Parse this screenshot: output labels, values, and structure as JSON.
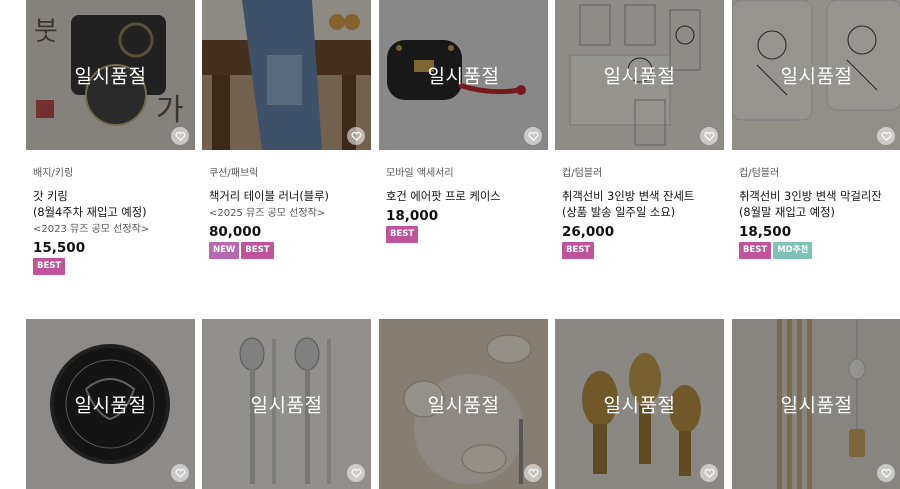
{
  "overlay_text": "일시품절",
  "colors": {
    "best": "#c0549b",
    "new": "#b76ab0",
    "md": "#7fc3b8",
    "overlay": "rgba(20,20,20,0.42)"
  },
  "products": [
    {
      "category": "배지/키링",
      "name_line1": "갓 키링",
      "name_line2": "(8월4주차 재입고 예정)",
      "subtitle": "<2023 뮤즈 공모 선정작>",
      "price": "15,500",
      "badges": [
        "BEST"
      ],
      "image": "hat keyring on calligraphy background"
    },
    {
      "category": "쿠션/패브릭",
      "name_line1": "책거리 테이블 러너(블루)",
      "name_line2": "",
      "subtitle": "<2025 뮤즈 공모 선정작>",
      "price": "80,000",
      "badges": [
        "NEW",
        "BEST"
      ],
      "image": "blue table runner on wooden table"
    },
    {
      "category": "모바일 액세서리",
      "name_line1": "호건 에어팟 프로 케이스",
      "name_line2": "",
      "subtitle": "",
      "price": "18,000",
      "badges": [
        "BEST"
      ],
      "image": "black airpods case with red tassel"
    },
    {
      "category": "컵/텀블러",
      "name_line1": "취객선비 3인방 변색 잔세트",
      "name_line2": "(상품 발송 일주일 소요)",
      "subtitle": "",
      "price": "26,000",
      "badges": [
        "BEST"
      ],
      "image": "glass cup set with scholar drawings"
    },
    {
      "category": "컵/텀블러",
      "name_line1": "취객선비 3인방 변색 막걸리잔",
      "name_line2": "(8월말 재입고 예정)",
      "subtitle": "",
      "price": "18,500",
      "badges": [
        "BEST",
        "MD추천"
      ],
      "image": "makgeolli glasses"
    },
    {
      "category": "",
      "name_line1": "",
      "name_line2": "",
      "subtitle": "",
      "price": "",
      "badges": [],
      "image": "black dragon coaster"
    },
    {
      "category": "",
      "name_line1": "",
      "name_line2": "",
      "subtitle": "",
      "price": "",
      "badges": [],
      "image": "spoon and chopsticks set"
    },
    {
      "category": "",
      "name_line1": "",
      "name_line2": "",
      "subtitle": "",
      "price": "",
      "badges": [],
      "image": "ceramic pieces and cutlery"
    },
    {
      "category": "",
      "name_line1": "",
      "name_line2": "",
      "subtitle": "",
      "price": "",
      "badges": [],
      "image": "golden incense burner ornaments"
    },
    {
      "category": "",
      "name_line1": "",
      "name_line2": "",
      "subtitle": "",
      "price": "",
      "badges": [],
      "image": "wooden sticks with hanging bell"
    }
  ]
}
